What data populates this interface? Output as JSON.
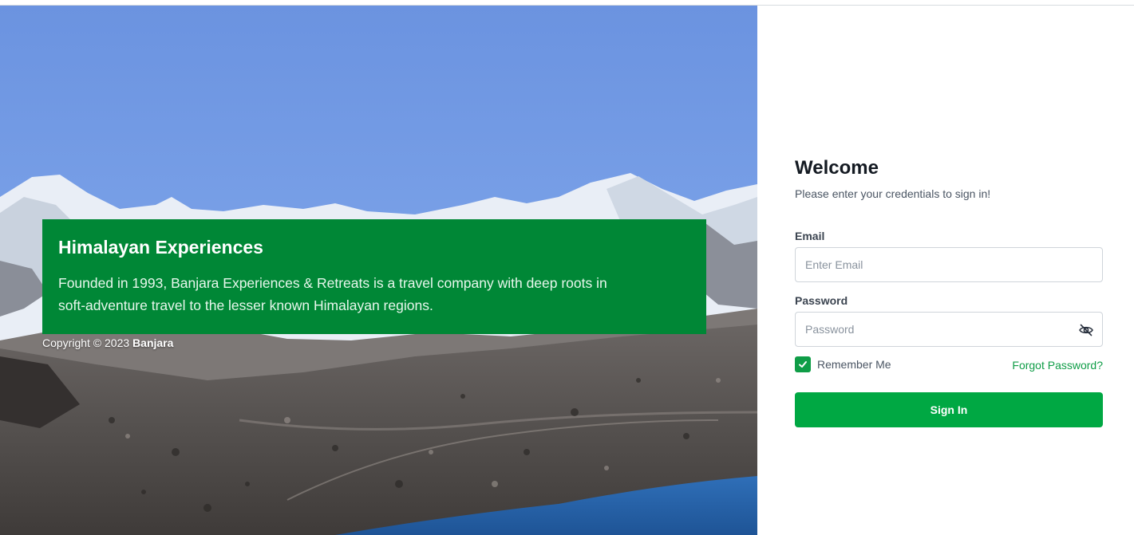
{
  "hero": {
    "title": "Himalayan Experiences",
    "description": "Founded in 1993, Banjara Experiences & Retreats is a travel company with deep roots in soft-adventure travel to the lesser known Himalayan regions.",
    "copyright_prefix": "Copyright © 2023",
    "copyright_brand": "Banjara",
    "image": "himalayan-mountain-lake-landscape"
  },
  "login": {
    "heading": "Welcome",
    "subtitle": "Please enter your credentials to sign in!",
    "email": {
      "label": "Email",
      "placeholder": "Enter Email",
      "value": ""
    },
    "password": {
      "label": "Password",
      "placeholder": "Password",
      "value": "",
      "toggle_icon": "eye-off-icon"
    },
    "remember": {
      "label": "Remember Me",
      "checked": true
    },
    "forgot_label": "Forgot Password?",
    "submit_label": "Sign In"
  },
  "colors": {
    "promo_green": "#008736",
    "accent_green": "#00a843",
    "link_green": "#0f9d47"
  }
}
